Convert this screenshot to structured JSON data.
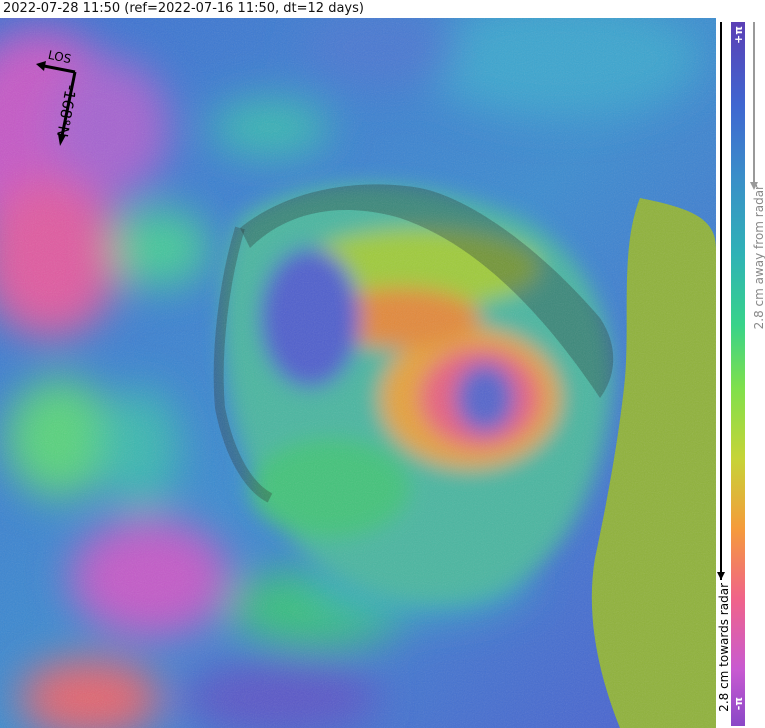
{
  "title": "2022-07-28 11:50 (ref=2022-07-16 11:50, dt=12 days)",
  "compass": {
    "los_label": "LOS",
    "heading_label": "-168°N"
  },
  "colorbar": {
    "top_label": "+π",
    "bottom_label": "-π",
    "away_label": "2.8 cm away from radar",
    "towards_label": "2.8 cm towards radar"
  },
  "colors": {
    "background_blue": "#3f7ad0",
    "magenta": "#c65ac5",
    "green_overlay": "#8fb23a"
  }
}
